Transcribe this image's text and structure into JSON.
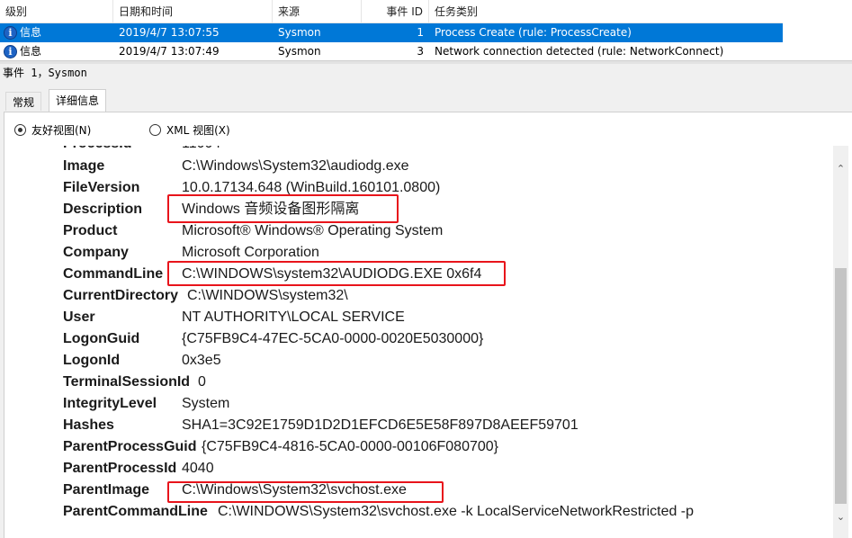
{
  "columns": {
    "level": "级别",
    "datetime": "日期和时间",
    "source": "来源",
    "event_id": "事件 ID",
    "task_category": "任务类别"
  },
  "events": [
    {
      "level": "信息",
      "datetime": "2019/4/7 13:07:55",
      "source": "Sysmon",
      "event_id": "1",
      "task_category": "Process Create (rule: ProcessCreate)",
      "selected": true
    },
    {
      "level": "信息",
      "datetime": "2019/4/7 13:07:49",
      "source": "Sysmon",
      "event_id": "3",
      "task_category": "Network connection detected (rule: NetworkConnect)",
      "selected": false
    }
  ],
  "event_title": "事件 1，Sysmon",
  "tabs": {
    "general": "常规",
    "details": "详细信息"
  },
  "view_options": {
    "friendly": "友好视图(N)",
    "xml": "XML 视图(X)"
  },
  "details": [
    {
      "key": "Image",
      "value": "C:\\Windows\\System32\\audiodg.exe"
    },
    {
      "key": "FileVersion",
      "value": "10.0.17134.648 (WinBuild.160101.0800)"
    },
    {
      "key": "Description",
      "value": "Windows 音频设备图形隔离"
    },
    {
      "key": "Product",
      "value": "Microsoft® Windows® Operating System"
    },
    {
      "key": "Company",
      "value": "Microsoft Corporation"
    },
    {
      "key": "CommandLine",
      "value": "C:\\WINDOWS\\system32\\AUDIODG.EXE 0x6f4"
    },
    {
      "key": "CurrentDirectory",
      "value": "C:\\WINDOWS\\system32\\"
    },
    {
      "key": "User",
      "value": "NT AUTHORITY\\LOCAL SERVICE"
    },
    {
      "key": "LogonGuid",
      "value": "{C75FB9C4-47EC-5CA0-0000-0020E5030000}"
    },
    {
      "key": "LogonId",
      "value": "0x3e5"
    },
    {
      "key": "TerminalSessionId",
      "value": "0"
    },
    {
      "key": "IntegrityLevel",
      "value": "System"
    },
    {
      "key": "Hashes",
      "value": "SHA1=3C92E1759D1D2D1EFCD6E5E58F897D8AEEF59701"
    },
    {
      "key": "ParentProcessGuid",
      "value": "{C75FB9C4-4816-5CA0-0000-00106F080700}"
    },
    {
      "key": "ParentProcessId",
      "value": "4040"
    },
    {
      "key": "ParentImage",
      "value": "C:\\Windows\\System32\\svchost.exe"
    },
    {
      "key": "ParentCommandLine",
      "value": "C:\\WINDOWS\\System32\\svchost.exe -k LocalServiceNetworkRestricted -p"
    }
  ],
  "colors": {
    "selection": "#0078d7",
    "highlight_box": "#e8141b",
    "info_icon": "#1d63c4"
  }
}
